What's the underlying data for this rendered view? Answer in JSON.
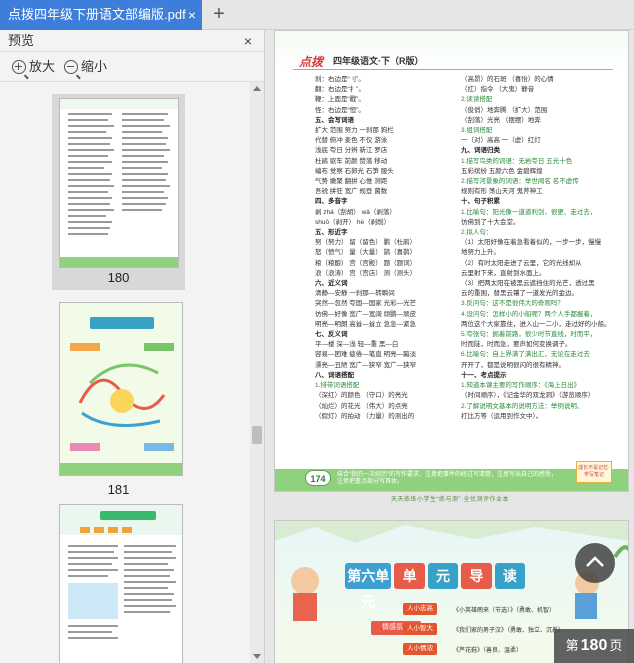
{
  "tab": {
    "title": "点拨四年级下册语文部编版.pdf",
    "close": "×",
    "new_tab": "+"
  },
  "sidebar": {
    "title": "预览",
    "close": "×",
    "zoom_in": "放大",
    "zoom_out": "缩小",
    "thumbnails": [
      {
        "label": "180",
        "selected": true
      },
      {
        "label": "181",
        "selected": false
      },
      {
        "label": "",
        "selected": false
      }
    ]
  },
  "page180": {
    "logo": "点拨",
    "title": "四年级语文·下（R版）",
    "col1": [
      "刹：右边是“刂”。",
      "翻：右边是“扌”。",
      "鞭：上面是“戳”。",
      "怪：右边是“恒”。",
      "五、会写词语",
      "扩大  范围  努力  一刹那  狗栏",
      "代替  俯冲  麦色  不仅  游泳",
      "浅底  夸日  分辨  新江  罗店",
      "杜鹃  驱车  前颜  赞落  移动",
      "编布  觉察  石卵光  石笋  服头",
      "气势  嫩聚  翻拼  心惟  测距",
      "吾锐  拼狂  宽广  规登  菌数",
      "四、多音字",
      "剥  zhá（刮胡）  wǎ（剥落）",
      "     shuō（剥开）    hè（剥削）",
      "五、形近字",
      "努（努力）  留（留色）  鹏（杜鹃）",
      "怒（愤气）  量（大量）  鹊（喜鹊）",
      "粮（粮酿）  宫（宫殿）  题（题词）",
      "浪（浪涛）  宫（宫店）  测（测头）",
      "六、近义词",
      "清静—安静  一刹那—转瞬间",
      "突然—忽然  夸国—国家  光彩—光芒",
      "仿佛—好像  宽广—宽阔  顽鹏—顽皮",
      "明亮—明朗  高耸—耸立  急急—紧急",
      "七、反义词",
      "平—楼  深—浅  轻—重  黑—白",
      "容易—困难  疲倦—笔直  明亮—黯淡",
      "漂亮—丑陋  宽广—狭窄  宽广—狭窄",
      "八、词语搭配",
      "1.排带词语搭配",
      "（深红）的颜色  （守口）的亮光",
      "（灿烂）的花光  （伟大）的点亮",
      "（假灯）的拍动  （力量）的测出的"
    ],
    "col2": [
      "（高昂）的石斑  （喜怡）的心情",
      "（扛）指令  （大鬼）静音",
      "2.读读搭配",
      "（俊俏）地奔腾  （扩大）范围",
      "（刮落）光亮  （摆摆）地奔",
      "3.组词搭配",
      "一（对）高高    一（虚）红灯",
      "九、词语归类",
      "1.描写鸟类的词语：无岩夸日  五光十色",
      "   五彩缤纷  五颜六色  金碧辉煌",
      "2.描写河景象的词语：举世闻名  名不虚传",
      "   规则有形  荡山天河  鬼斧神工",
      "十、句子积累",
      "1.比喻句：阳光像一道道利剑，很更、走过去，",
      "   仿佛到了十大会堂。",
      "2.拟人句：",
      "  （1）太阳好像在着急看着似的，一步一步，慢慢",
      "   地努力上升。",
      "  （2）有时太阳走进了云里，它的光线却从",
      "   云里射下来，直射到水面上。",
      "  （3）把两太阳在被黑云遮挡住的光芒，透过黑",
      "   云的重围，替黑云镶了一道发光的金边。",
      "3.反问句：这不是很伟大的奇观吗？",
      "4.设问句：怎样小的小船呢？两个人手都握着，",
      "   两位这个大家靠住，进入山一二小，走过好的小船。",
      "5.夸张句：掘着前路，很少时节直线，时而平，",
      "   时而陡，时而急，要声如何变换调子。",
      "6.比喻句：自上界满了满出汇，无论在走过去",
      "   开开了，都是说明很闪的很有精神。",
      "十一、考点提示",
      "1.知道本课主要的写作顺序：《海上日出》",
      "  （时间顺序），《记金华的双龙洞》（游览顺序）",
      "2.了解说明文基本的说明方法：举例说明、",
      "   打比方等（运用到作文中）。"
    ],
    "page_number": "174",
    "footnote": "结合“我的一次经历”的写作要求，注意把事件的经过写清楚，注意写出自己的感受，注意把重点部分写具体。",
    "badge": "成长不是记忆·学写笔记"
  },
  "separator": "天天练练小学生“练与测”·全优测评作业本",
  "page181": {
    "banner_lead": "第六单元",
    "banner_words": [
      "单",
      "元",
      "导",
      "读"
    ],
    "left_box": "情感氛围",
    "nodes": [
      {
        "label": "人小志高",
        "text": "《小英雄雨来（节选）》（勇敢、机智）"
      },
      {
        "label": "人小智大",
        "text": "《我们家的男子汉》（勇敢、独立、沉着）"
      },
      {
        "label": "人小情浓",
        "text": "《芦花鞋》（善良、温柔）"
      }
    ]
  },
  "page_indicator": {
    "prefix": "第",
    "number": "180",
    "suffix": "页"
  },
  "colors": {
    "tab_active": "#3d7edb",
    "accent_green": "#8fd17c",
    "banner_red": "#e75b4b",
    "banner_blue": "#37a1c8"
  }
}
